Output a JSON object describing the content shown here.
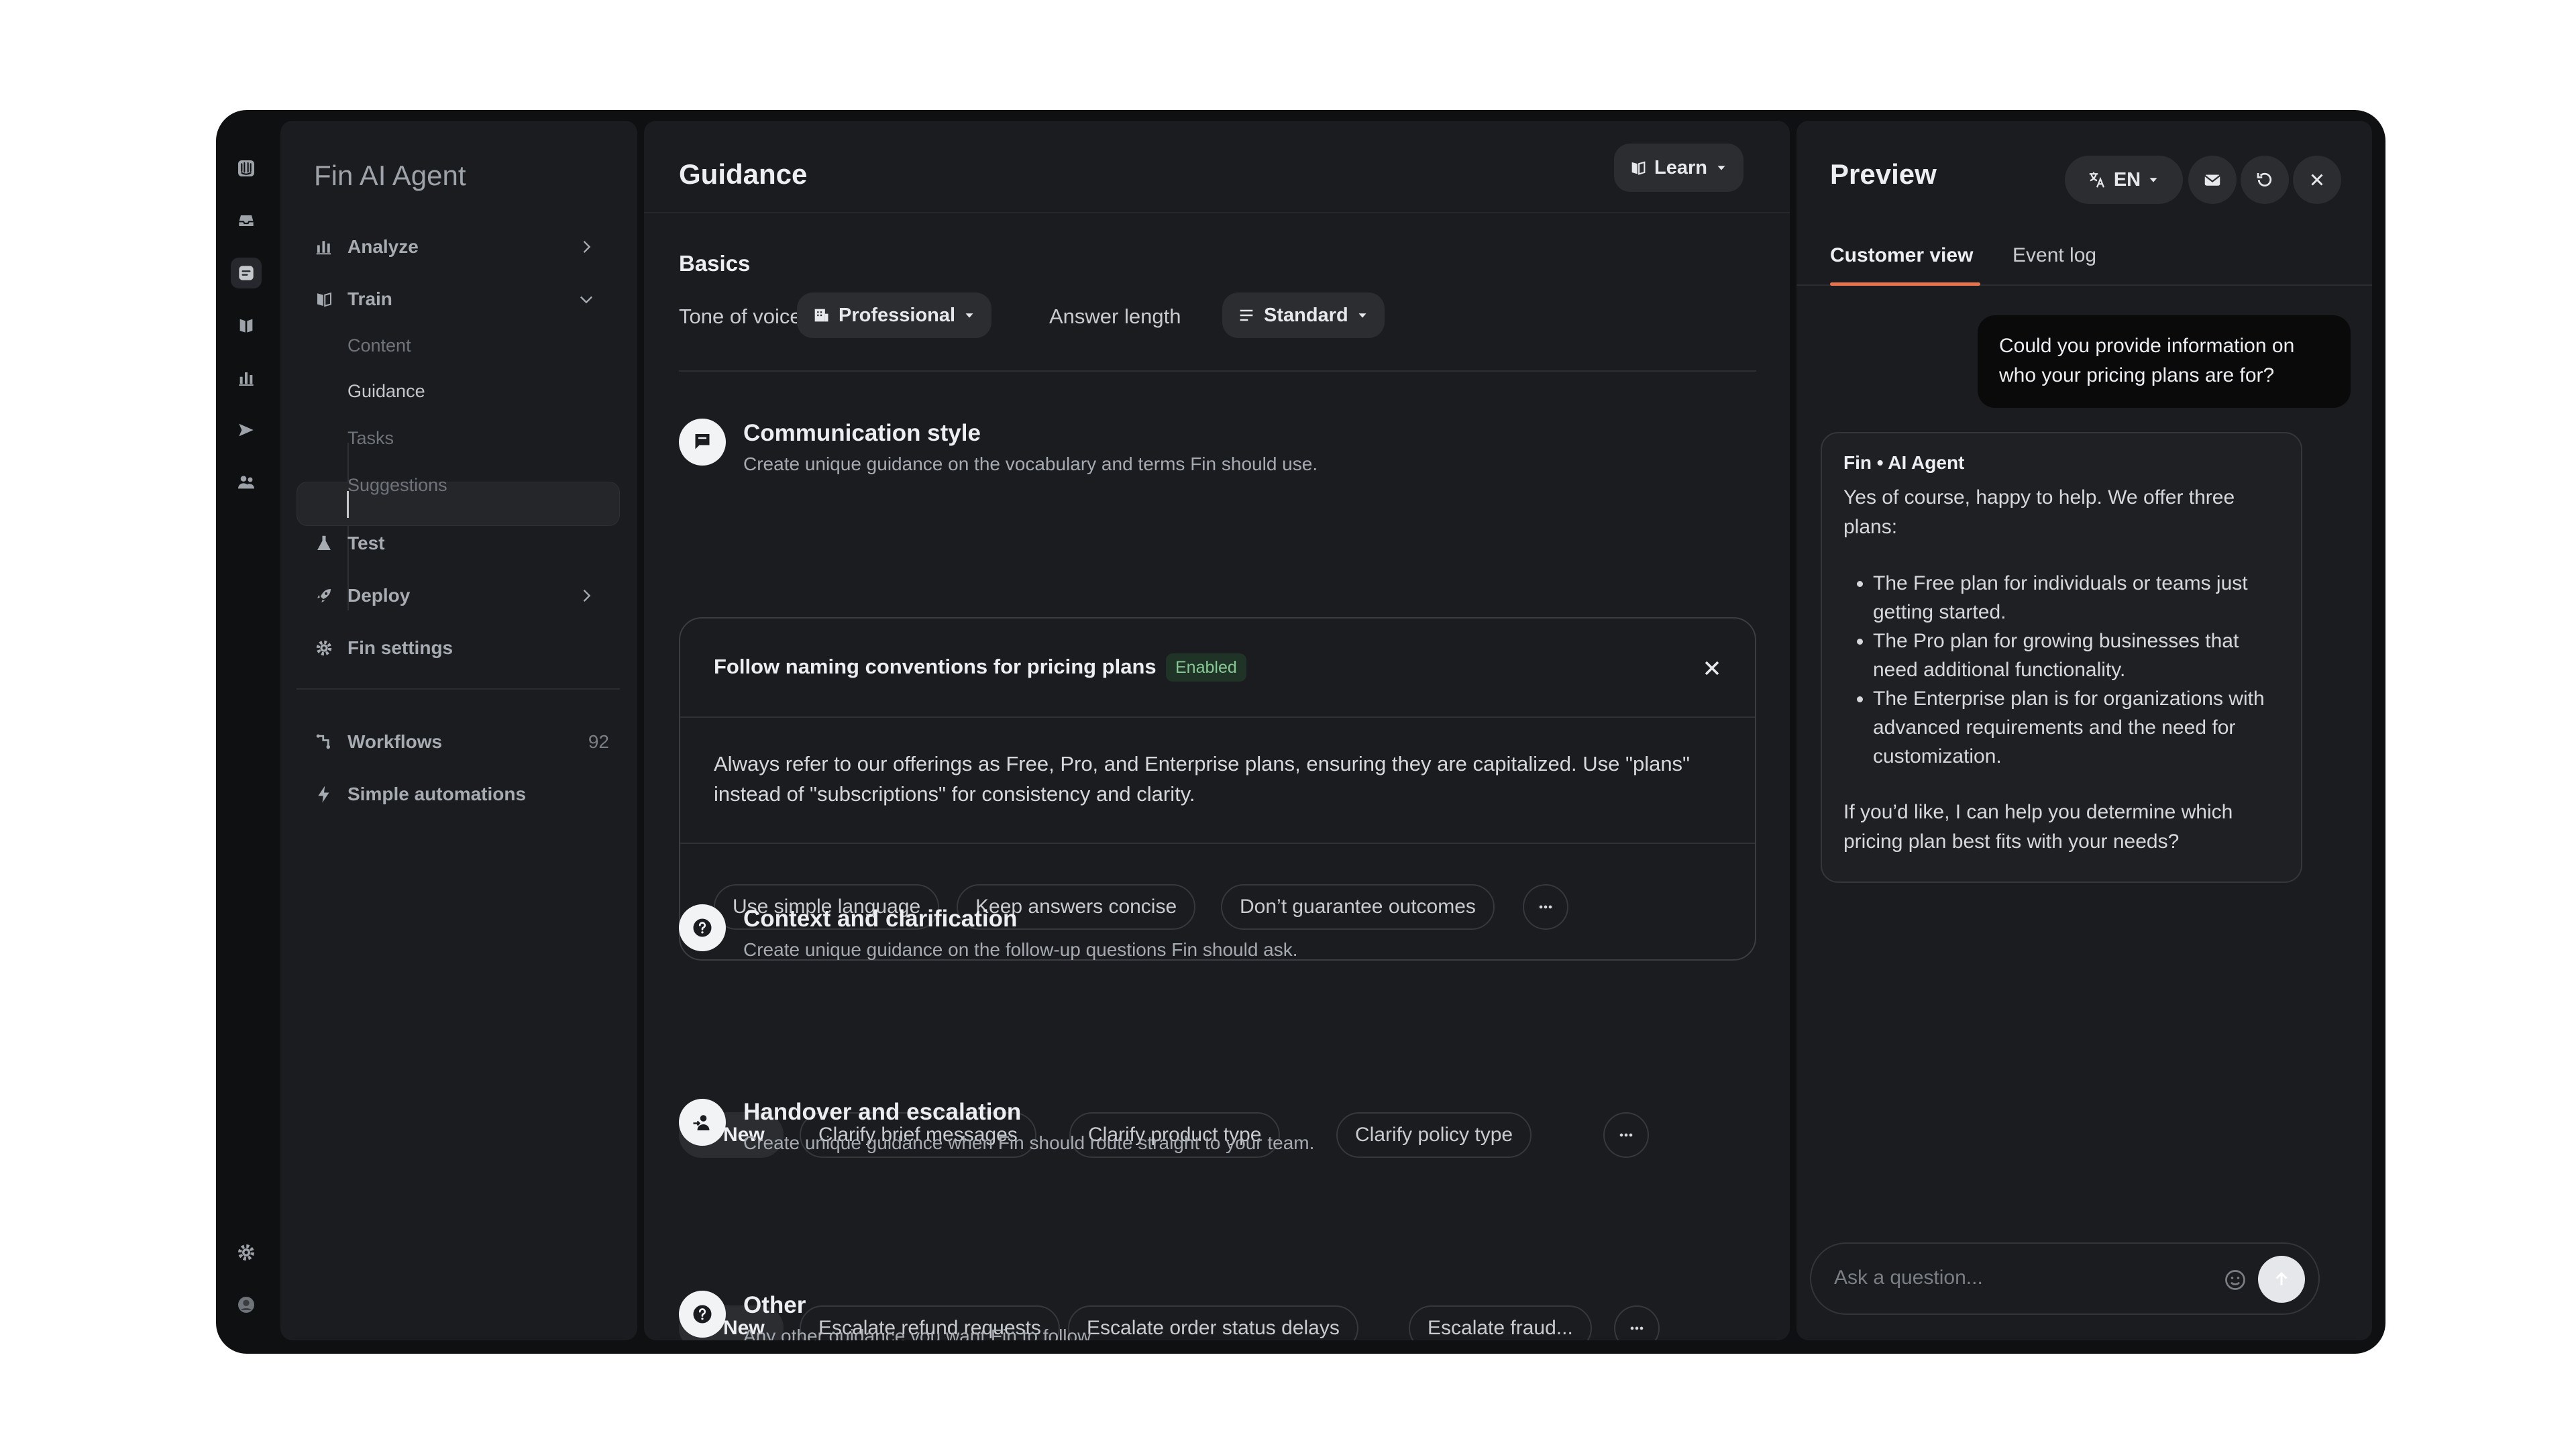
{
  "sidebar": {
    "title": "Fin AI Agent",
    "items": {
      "analyze": "Analyze",
      "train": "Train",
      "test": "Test",
      "deploy": "Deploy",
      "fin_settings": "Fin settings",
      "workflows": "Workflows",
      "workflows_count": "92",
      "simple_automations": "Simple automations"
    },
    "train_sub": {
      "content": "Content",
      "guidance": "Guidance",
      "tasks": "Tasks",
      "suggestions": "Suggestions"
    }
  },
  "main": {
    "title": "Guidance",
    "learn_label": "Learn",
    "basics": {
      "heading": "Basics",
      "tone_label": "Tone of voice",
      "tone_value": "Professional",
      "length_label": "Answer length",
      "length_value": "Standard"
    },
    "communication": {
      "title": "Communication style",
      "desc": "Create unique guidance on the vocabulary and terms Fin should use.",
      "card_title": "Follow naming conventions for pricing plans",
      "card_badge": "Enabled",
      "card_body": "Always refer to our offerings as Free, Pro, and Enterprise plans, ensuring they are capitalized. Use \"plans\" instead of \"subscriptions\" for consistency and clarity.",
      "chips": [
        "Use simple language",
        "Keep answers concise",
        "Don’t guarantee outcomes"
      ]
    },
    "context": {
      "title": "Context and clarification",
      "desc": "Create unique guidance on the follow-up questions Fin should ask.",
      "new_label": "New",
      "chips": [
        "Clarify brief messages",
        "Clarify product type",
        "Clarify policy type"
      ]
    },
    "handover": {
      "title": "Handover and escalation",
      "desc": "Create unique guidance when Fin should route straight to your team.",
      "new_label": "New",
      "chips": [
        "Escalate refund requests",
        "Escalate order status delays",
        "Escalate fraud..."
      ]
    },
    "other": {
      "title": "Other",
      "desc": "Any other guidance you want Fin to follow."
    }
  },
  "preview": {
    "title": "Preview",
    "language": "EN",
    "tabs": [
      "Customer view",
      "Event log"
    ],
    "user_message": "Could you provide information on who your pricing plans are for?",
    "fin_name": "Fin • AI Agent",
    "fin_intro": "Yes of course, happy to help. We offer three plans:",
    "fin_list": [
      "The Free plan for individuals or teams just getting started.",
      "The Pro plan for growing businesses that need additional functionality.",
      "The Enterprise plan is for organizations with advanced requirements and the need for customization."
    ],
    "fin_outro": "If you’d like, I can help you determine which pricing plan best fits with your needs?",
    "composer_placeholder": "Ask a question..."
  },
  "colors": {
    "accent_tab": "#e8734b",
    "badge_bg": "#1f3326",
    "badge_text": "#86c995"
  }
}
